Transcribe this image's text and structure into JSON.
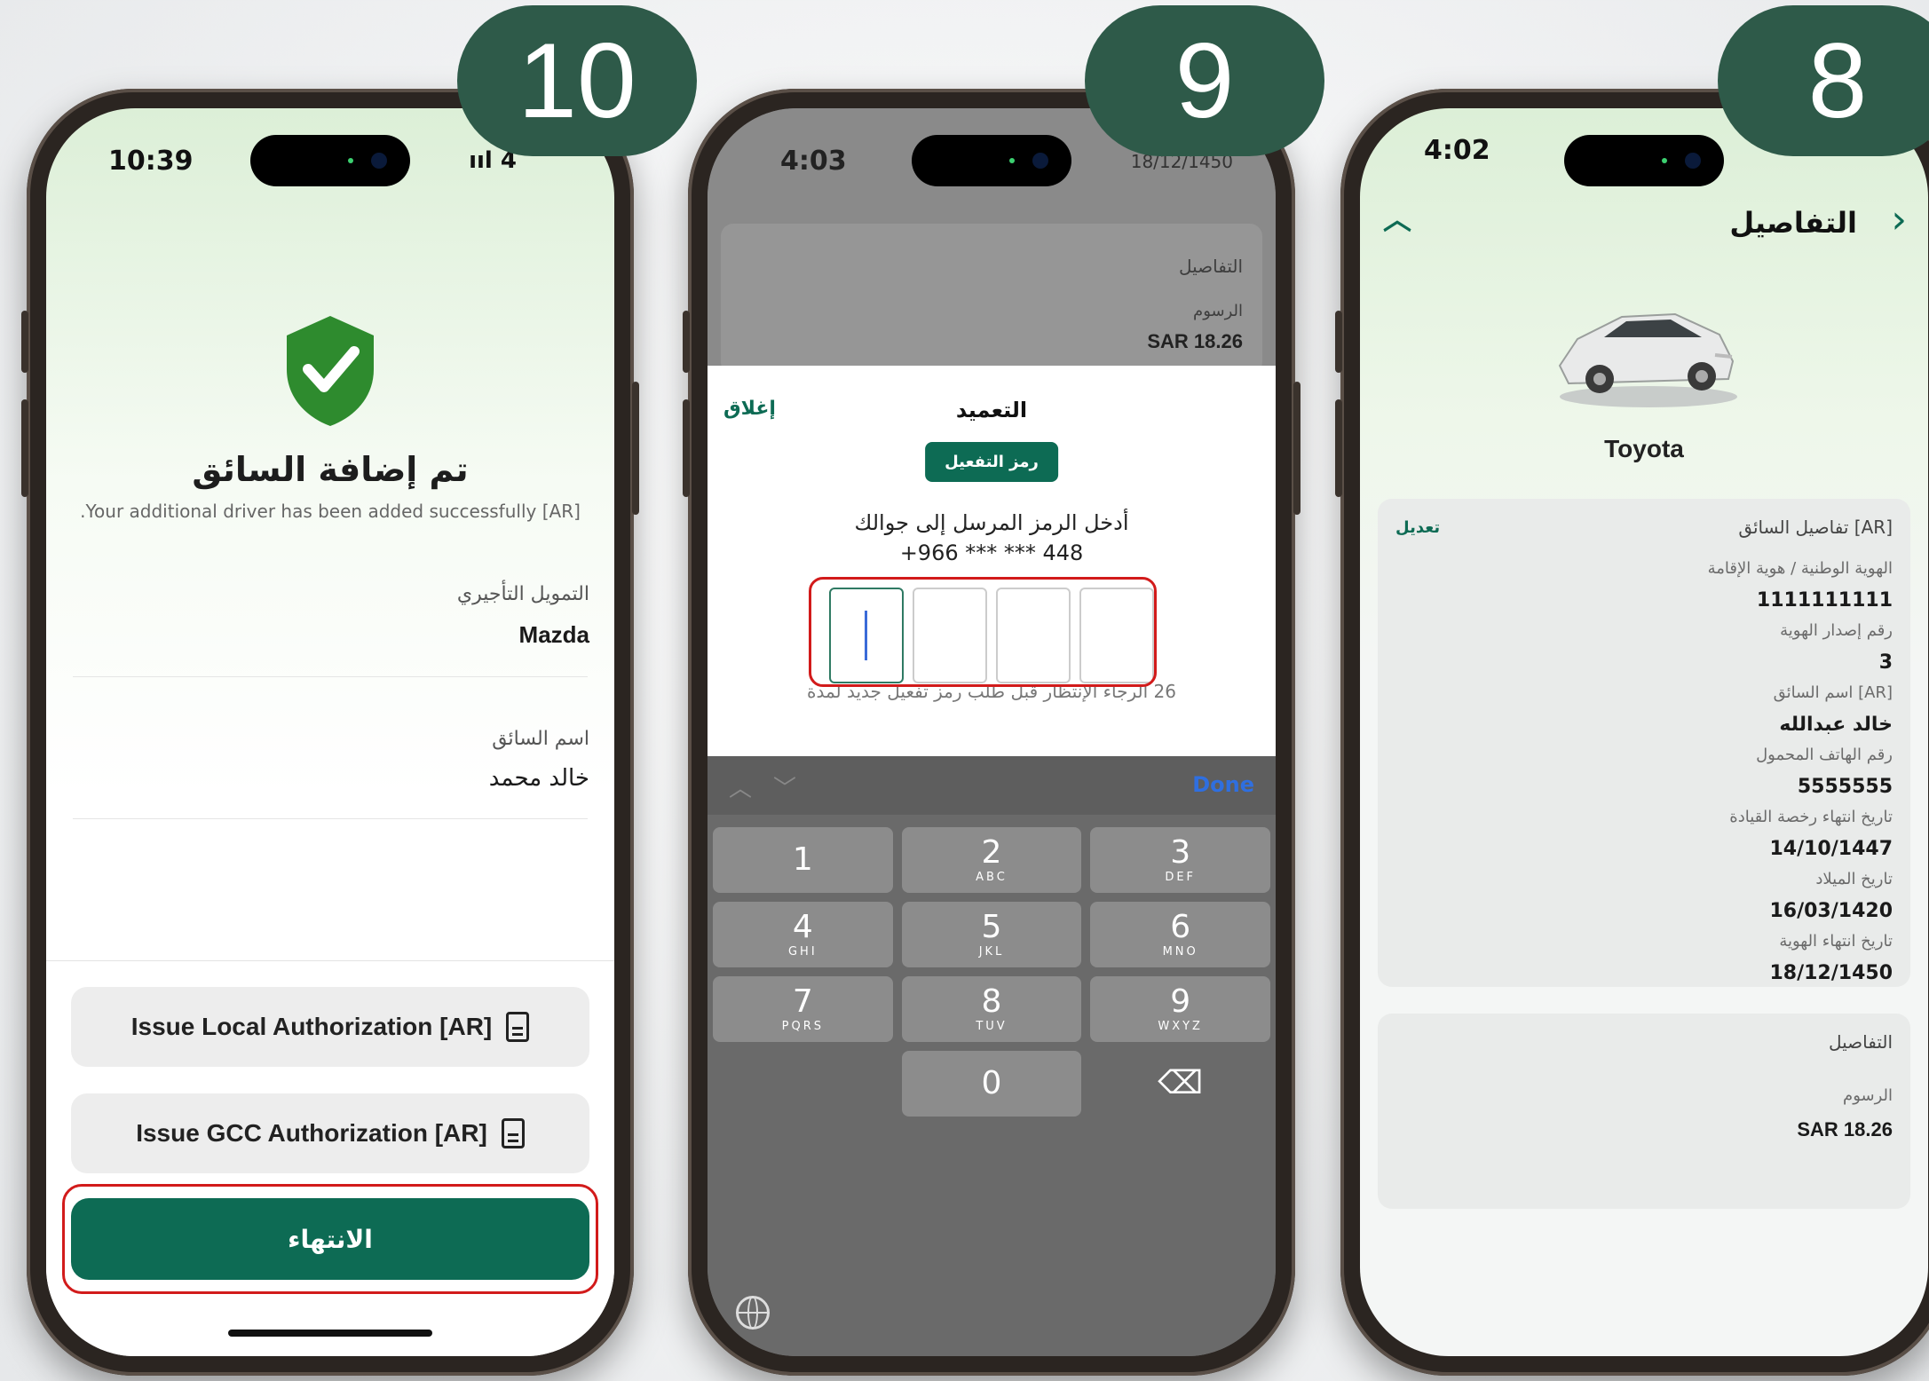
{
  "steps": {
    "left": "10",
    "middle": "9",
    "right": "8"
  },
  "phone10": {
    "time": "10:39",
    "status_icons": "ııl 4",
    "title": "تم إضافة السائق",
    "subtitle": ".Your additional driver has been added successfully [AR]",
    "financing_label": "التمويل التأجيري",
    "financing_value": "Mazda",
    "driver_label": "اسم السائق",
    "driver_value": "خالد محمد",
    "local_auth": "Issue Local Authorization [AR]",
    "gcc_auth": "Issue GCC Authorization [AR]",
    "finish": "الانتهاء",
    "colors": {
      "primary": "#0d6b54",
      "check": "#2e8b2e",
      "highlight": "#d21b1b"
    }
  },
  "phone9": {
    "time": "4:03",
    "bg_date": "18/12/1450",
    "bg_details": "التفاصيل",
    "bg_fees_label": "الرسوم",
    "bg_fees_value": "SAR 18.26",
    "modal_title": "التعميد",
    "close": "إغلاق",
    "activation_pill": "رمز التفعيل",
    "instruction_line1": "أدخل الرمز المرسل إلى جوالك",
    "instruction_line2": "+966 *** *** 448",
    "wait_text": "26 الرجاء الإنتظار قبل طلب رمز تفعيل جديد لمدة",
    "done": "Done",
    "keys": [
      {
        "num": "1",
        "letters": ""
      },
      {
        "num": "2",
        "letters": "ABC"
      },
      {
        "num": "3",
        "letters": "DEF"
      },
      {
        "num": "4",
        "letters": "GHI"
      },
      {
        "num": "5",
        "letters": "JKL"
      },
      {
        "num": "6",
        "letters": "MNO"
      },
      {
        "num": "7",
        "letters": "PQRS"
      },
      {
        "num": "8",
        "letters": "TUV"
      },
      {
        "num": "9",
        "letters": "WXYZ"
      },
      {
        "num": "",
        "letters": ""
      },
      {
        "num": "0",
        "letters": ""
      },
      {
        "num": "⌫",
        "letters": ""
      }
    ]
  },
  "phone8": {
    "time": "4:02",
    "title": "التفاصيل",
    "car_name": "Toyota",
    "section_title": "[AR] تفاصيل السائق",
    "edit": "تعديل",
    "fields": [
      {
        "label": "الهوية الوطنية / هوية الإقامة",
        "value": "1111111111"
      },
      {
        "label": "رقم إصدار الهوية",
        "value": "3"
      },
      {
        "label": "[AR] اسم السائق",
        "value": "خالد عبدالله"
      },
      {
        "label": "رقم الهاتف المحمول",
        "value": "5555555"
      },
      {
        "label": "تاريخ انتهاء رخصة القيادة",
        "value": "14/10/1447"
      },
      {
        "label": "تاريخ الميلاد",
        "value": "16/03/1420"
      },
      {
        "label": "تاريخ انتهاء الهوية",
        "value": "18/12/1450"
      }
    ],
    "details_title": "التفاصيل",
    "fees_label": "الرسوم",
    "fees_value": "SAR 18.26"
  }
}
